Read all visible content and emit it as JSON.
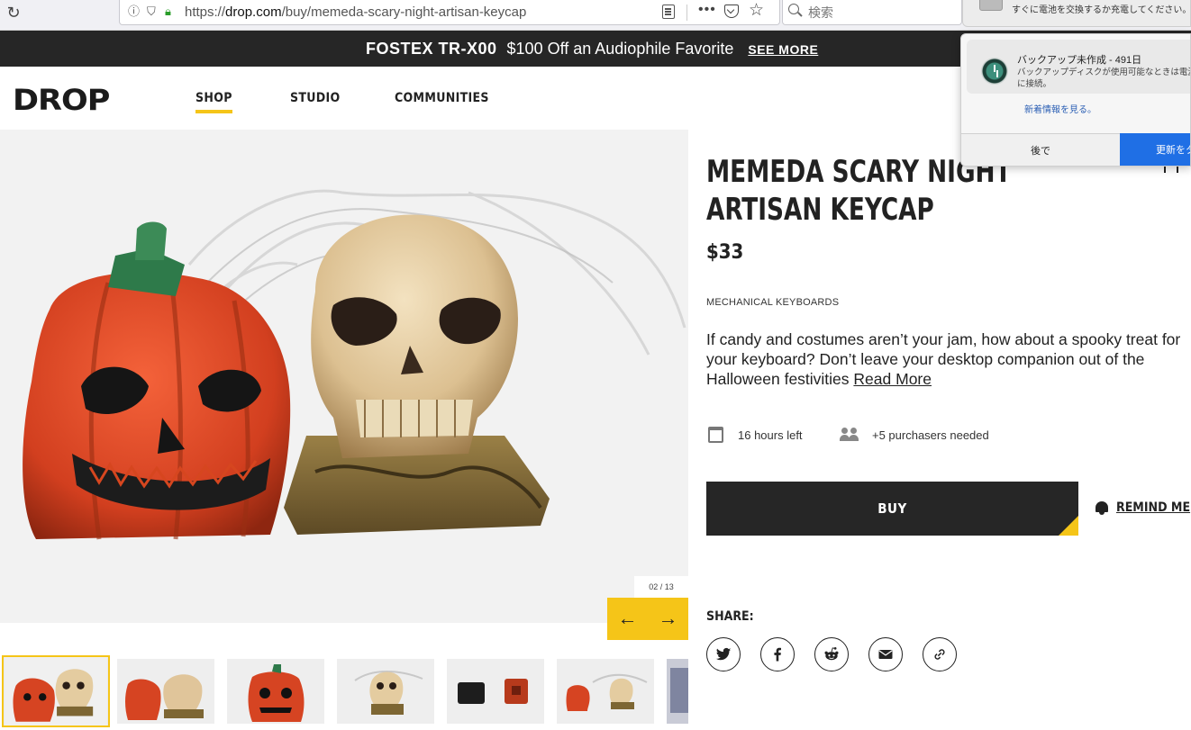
{
  "browser": {
    "url_host_prefix": "https://",
    "url_host": "drop.com",
    "url_path": "/buy/memeda-scary-night-artisan-keycap",
    "search_placeholder": "検索"
  },
  "promo": {
    "brand": "FOSTEX TR-X00",
    "offer": "$100 Off an Audiophile Favorite",
    "link": "SEE MORE"
  },
  "header": {
    "logo": "DROP",
    "nav": [
      "SHOP",
      "STUDIO",
      "COMMUNITIES"
    ],
    "active_nav": "SHOP"
  },
  "gallery": {
    "counter": "02 / 13",
    "thumbnail_count_visible": 7,
    "active_thumbnail": 1
  },
  "product": {
    "title": "MEMEDA SCARY NIGHT ARTISAN KEYCAP",
    "price": "$33",
    "category": "MECHANICAL KEYBOARDS",
    "description": "If candy and costumes aren’t your jam, how about a spooky treat for your keyboard? Don’t leave your desktop companion out of the Halloween festivities",
    "read_more": "Read More",
    "time_left": "16 hours left",
    "purchasers": "+5 purchasers needed",
    "buy_label": "BUY",
    "remind_label": "REMIND ME",
    "share_label": "SHARE:"
  },
  "share_icons": [
    "twitter-icon",
    "facebook-icon",
    "reddit-icon",
    "email-icon",
    "link-icon"
  ],
  "notifications": {
    "battery_text": "すぐに電池を交換するか充電してください。",
    "backup_title": "バックアップ未作成 - 491日",
    "backup_body": "バックアップディスクが使用可能なときは電源に接続。",
    "whats_new": "新着情報を見る。",
    "later": "後で",
    "update": "更新をタ"
  },
  "colors": {
    "accent": "#f5c518",
    "dark": "#262626",
    "macos_blue": "#1f6fe5"
  }
}
